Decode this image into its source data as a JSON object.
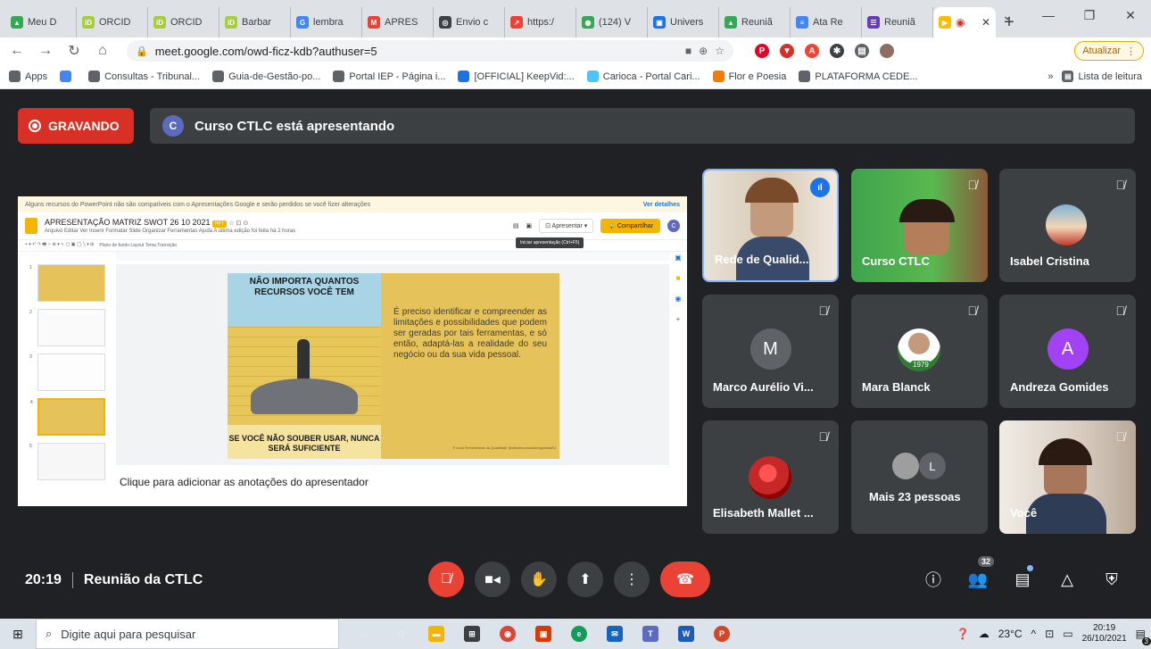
{
  "browser": {
    "tabs": [
      {
        "title": "Meu D",
        "color": "#34a853",
        "glyph": "▲"
      },
      {
        "title": "ORCID",
        "color": "#a6ce39",
        "glyph": "iD"
      },
      {
        "title": "ORCID",
        "color": "#a6ce39",
        "glyph": "iD"
      },
      {
        "title": "Barbar",
        "color": "#a6ce39",
        "glyph": "iD"
      },
      {
        "title": "lembra",
        "color": "#4285f4",
        "glyph": "G"
      },
      {
        "title": "APRES",
        "color": "#ea4335",
        "glyph": "M"
      },
      {
        "title": "Envio c",
        "color": "#3c4043",
        "glyph": "◎"
      },
      {
        "title": "https:/",
        "color": "#ea4335",
        "glyph": "↗"
      },
      {
        "title": "(124) V",
        "color": "#34a853",
        "glyph": "◉"
      },
      {
        "title": "Univers",
        "color": "#1a73e8",
        "glyph": "▣"
      },
      {
        "title": "Reuniã",
        "color": "#34a853",
        "glyph": "▲"
      },
      {
        "title": "Ata Re",
        "color": "#4285f4",
        "glyph": "≡"
      },
      {
        "title": "Reuniã",
        "color": "#673ab7",
        "glyph": "☰"
      }
    ],
    "new_tab": "+",
    "url": "meet.google.com/owd-ficz-kdb?authuser=5",
    "update_label": "Atualizar",
    "bookmarks": [
      {
        "label": "Apps",
        "color": "#5f6368"
      },
      {
        "label": "",
        "color": "#4285f4"
      },
      {
        "label": "Consultas - Tribunal...",
        "color": "#5f6368"
      },
      {
        "label": "Guia-de-Gestão-po...",
        "color": "#5f6368"
      },
      {
        "label": "Portal IEP - Página i...",
        "color": "#5f6368"
      },
      {
        "label": "[OFFICIAL] KeepVid:...",
        "color": "#1a73e8"
      },
      {
        "label": "Carioca - Portal Cari...",
        "color": "#4fc3f7"
      },
      {
        "label": "Flor e Poesia",
        "color": "#f57c00"
      },
      {
        "label": "PLATAFORMA CEDE...",
        "color": "#5f6368"
      }
    ],
    "reading_list": "Lista de leitura",
    "more_bookmarks": "»"
  },
  "meet": {
    "recording_label": "GRAVANDO",
    "presenter_initial": "C",
    "presenting_text": "Curso CTLC está apresentando",
    "meeting_time": "20:19",
    "meeting_name": "Reunião da CTLC",
    "participant_count": "32"
  },
  "slides": {
    "warning": "Alguns recursos do PowerPoint não são compatíveis com o Apresentações Google e serão perdidos se você fizer alterações",
    "warning_link": "Ver detalhes",
    "doc_title": "APRESENTAÇÃO MATRIZ SWOT 26 10 2021",
    "doc_badge": "PPT",
    "menu": "Arquivo  Editar  Ver  Inserir  Formatar  Slide  Organizar  Ferramentas  Ajuda  A última edição foi feita há 2 horas",
    "present_label": "Apresentar",
    "share_label": "Compartilhar",
    "tooltip": "Iniciar apresentação (Ctrl+F5)",
    "format_bar": "Plano de fundo   Layout   Tema   Transição",
    "slide_heading": "NÃO IMPORTA QUANTOS RECURSOS VOCÊ TEM",
    "slide_footer": "SE VOCÊ NÃO SOUBER USAR, NUNCA SERÁ SUFICIENTE",
    "slide_text": "É preciso identificar e compreender as limitações e possibilidades que podem ser geradas por tais ferramentas, e só então, adaptá-las a realidade do seu negócio ou da sua vida pessoal.",
    "slide_credit": "© Ioval Ferramentas da Qualidade @ctlctrecursosdaemgestaoRJ",
    "notes_placeholder": "Clique para adicionar as anotações do apresentador",
    "thumb_numbers": [
      "1",
      "2",
      "3",
      "4",
      "5"
    ]
  },
  "participants": [
    {
      "name": "Rede de Qualid...",
      "kind": "video",
      "speaking": true,
      "muted": false
    },
    {
      "name": "Curso CTLC",
      "kind": "video",
      "speaking": false,
      "muted": true
    },
    {
      "name": "Isabel Cristina",
      "kind": "photo",
      "speaking": false,
      "muted": true
    },
    {
      "name": "Marco Aurélio Vi...",
      "kind": "letter",
      "letter": "M",
      "color": "#5f6368",
      "muted": true
    },
    {
      "name": "Mara Blanck",
      "kind": "photo",
      "badge": "1979",
      "muted": true
    },
    {
      "name": "Andreza Gomides",
      "kind": "letter",
      "letter": "A",
      "color": "#a142f4",
      "muted": true
    },
    {
      "name": "Elisabeth Mallet ...",
      "kind": "photo",
      "muted": true
    },
    {
      "name": "Mais 23 pessoas",
      "kind": "more",
      "letter": "L",
      "muted": false
    },
    {
      "name": "Você",
      "kind": "video",
      "muted": true
    }
  ],
  "taskbar": {
    "search_placeholder": "Digite aqui para pesquisar",
    "temperature": "23°C",
    "time": "20:19",
    "date": "26/10/2021",
    "notif_count": "3"
  }
}
